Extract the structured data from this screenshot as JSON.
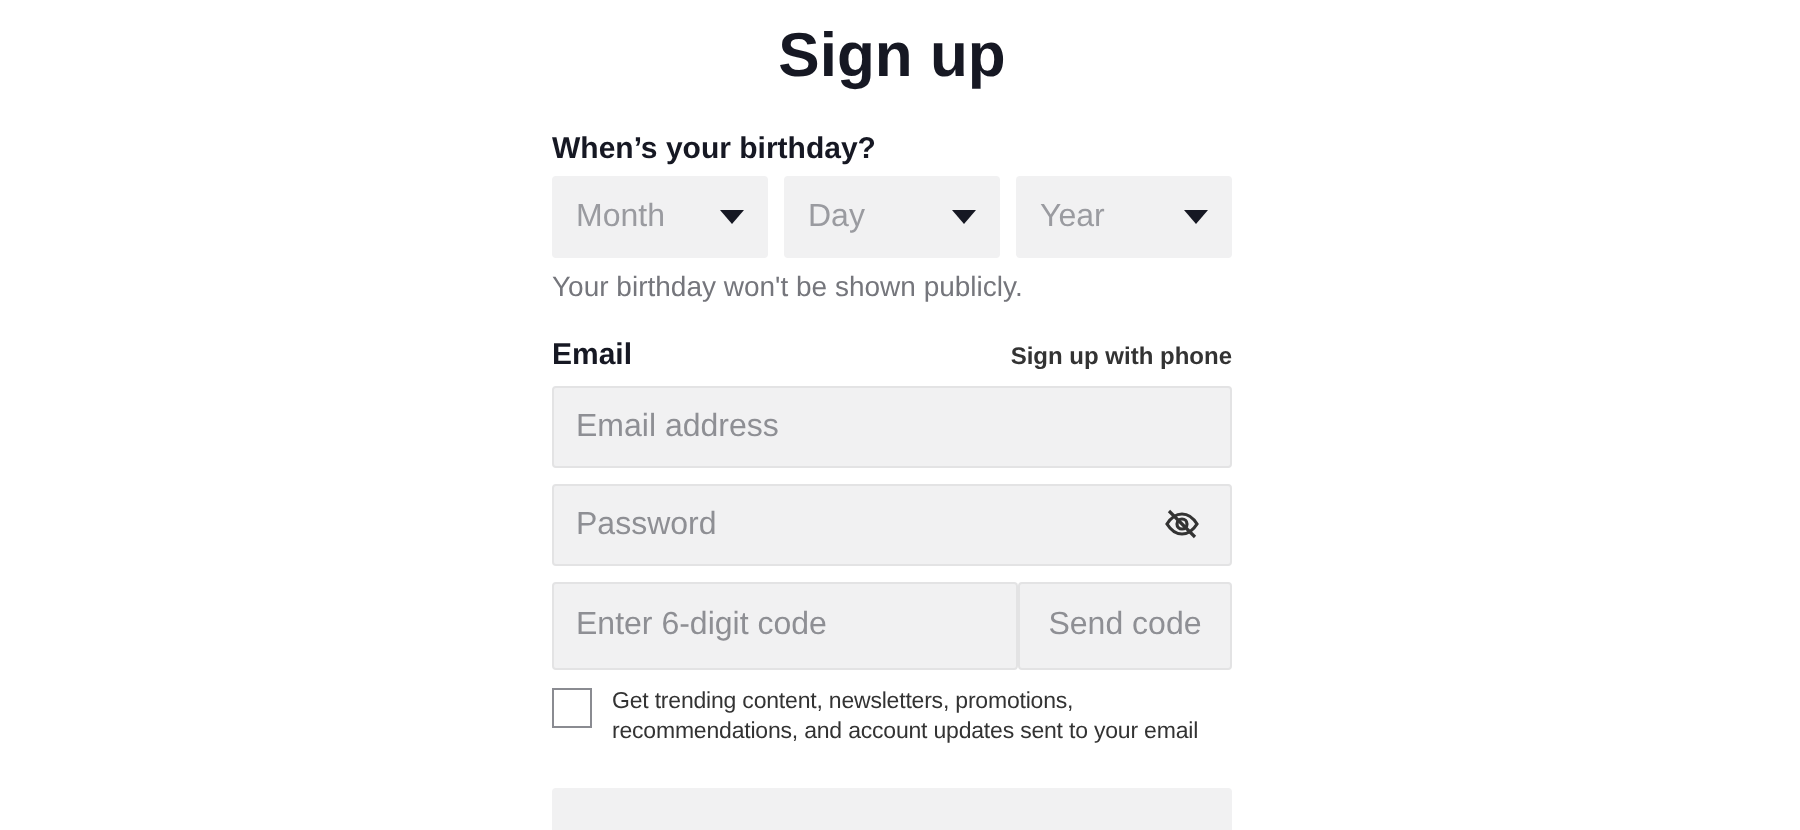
{
  "title": "Sign up",
  "birthday": {
    "label": "When’s your birthday?",
    "selects": [
      {
        "placeholder": "Month"
      },
      {
        "placeholder": "Day"
      },
      {
        "placeholder": "Year"
      }
    ],
    "hint": "Your birthday won't be shown publicly."
  },
  "email": {
    "label": "Email",
    "switch_link": "Sign up with phone",
    "address": {
      "placeholder": "Email address"
    },
    "password": {
      "placeholder": "Password",
      "visible": false
    },
    "code": {
      "placeholder": "Enter 6-digit code"
    },
    "send_code": {
      "label": "Send code",
      "disabled": true
    }
  },
  "consent": {
    "checked": false,
    "text": "Get trending content, newsletters, promotions, recommendations, and account updates sent to your email"
  },
  "next_button": {
    "disabled": true
  }
}
